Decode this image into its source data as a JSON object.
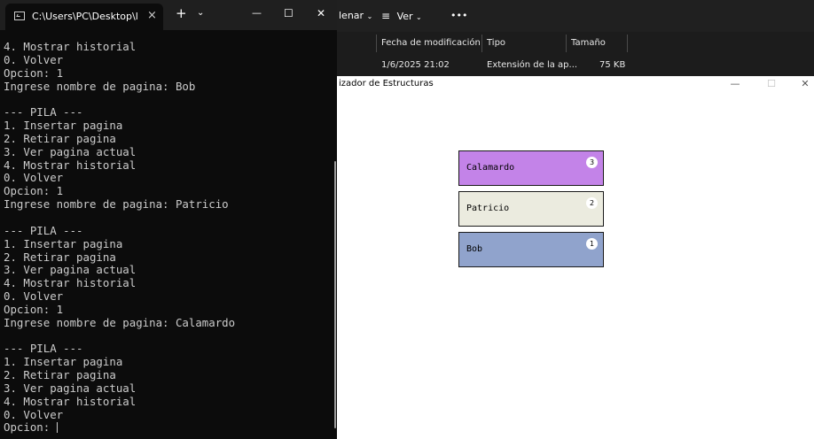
{
  "terminal": {
    "tab_title": "C:\\Users\\PC\\Desktop\\l",
    "tab_close": "×",
    "new_tab": "+",
    "tab_dropdown": "⌄",
    "minimize": "—",
    "maximize": "☐",
    "close": "✕",
    "lines": [
      "4. Mostrar historial",
      "0. Volver",
      "Opcion: 1",
      "Ingrese nombre de pagina: Bob",
      "",
      "--- PILA ---",
      "1. Insertar pagina",
      "2. Retirar pagina",
      "3. Ver pagina actual",
      "4. Mostrar historial",
      "0. Volver",
      "Opcion: 1",
      "Ingrese nombre de pagina: Patricio",
      "",
      "--- PILA ---",
      "1. Insertar pagina",
      "2. Retirar pagina",
      "3. Ver pagina actual",
      "4. Mostrar historial",
      "0. Volver",
      "Opcion: 1",
      "Ingrese nombre de pagina: Calamardo",
      "",
      "--- PILA ---",
      "1. Insertar pagina",
      "2. Retirar pagina",
      "3. Ver pagina actual",
      "4. Mostrar historial",
      "0. Volver"
    ],
    "prompt": "Opcion: "
  },
  "explorer": {
    "sort_label": "lenar",
    "view_label": "Ver",
    "more_label": "•••",
    "columns": [
      "Fecha de modificación",
      "Tipo",
      "Tamaño"
    ],
    "file_row": {
      "modified": "1/6/2025 21:02",
      "type": "Extensión de la ap...",
      "size": "75 KB"
    }
  },
  "visualizer": {
    "title": "izador de Estructuras",
    "minimize": "—",
    "maximize": "☐",
    "close": "✕",
    "stack": [
      {
        "label": "Calamardo",
        "badge": "3",
        "color": "#c383e8"
      },
      {
        "label": "Patricio",
        "badge": "2",
        "color": "#ebebdf"
      },
      {
        "label": "Bob",
        "badge": "1",
        "color": "#90a3cc"
      }
    ]
  }
}
